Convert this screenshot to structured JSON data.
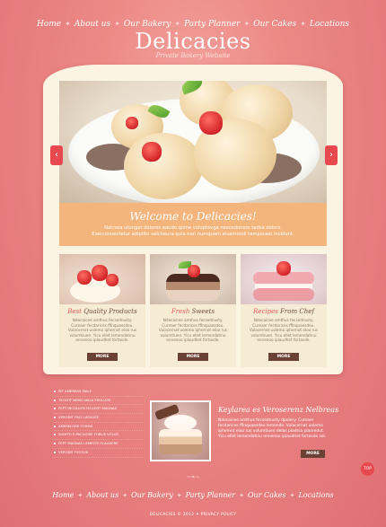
{
  "nav": {
    "items": [
      "Home",
      "About us",
      "Our Bakery",
      "Party Planner",
      "Our Cakes",
      "Locations"
    ],
    "separator": "✦"
  },
  "brand": {
    "name": "Delicacies",
    "tagline": "Private Bakery Website"
  },
  "slider": {
    "prev_icon": "‹",
    "next_icon": "›"
  },
  "welcome": {
    "title": "Welcome to Delicacies!",
    "text": "Natrsea utunget dolores eaudo quine voluptavga nescedonem tadsa delors. Exerconnectetur adipilici velcheura quia non numquam eiusmoodi temporaet incidunt."
  },
  "cards": [
    {
      "title_highlight": "Best",
      "title_rest": "Quality Products",
      "text": "Ndecaicee amthus fecsednusty. Cureaer fecdarices fflnquaesdeu. Vulacernat uolemo iphernot eloo rus volumtiuen. Yicu ellet lemendatinu ennenoo iplaudhet fortasde.",
      "button": "MORE"
    },
    {
      "title_highlight": "Fresh",
      "title_rest": "Sweets",
      "text": "Ndecaicee amthus fecsednusty. Cureaer fecdarices fflnquaesdeu. Vulacernat uolemo iphernot eloo rus volumtiuen. Yicu ellet lemendatinu ennenoo iplaudhet fortasde.",
      "button": "MORE"
    },
    {
      "title_highlight": "Recipes",
      "title_rest": "From Chef",
      "text": "Ndecaicee amthus fecsednusty. Cureaer fecdarices fflnquaesdeu. Vulacernat uolemo iphernot eloo rus volumtiuen. Yicu ellet lemendatinu ennenoo iplaudhet fortasde.",
      "button": "MORE"
    }
  ],
  "links": [
    "SIT AMEREAS MALE",
    "TEOLTIF NEMO NULA FROLUOS",
    "FEPT INCOLUOS MOLENT MAGNAS",
    "VERODIT PACI LAOLUSE",
    "AMERELORE FORSIS",
    "SIGHTO S PACIUOSE FORLIS VOLUS",
    "FEPT MAGNAS LEMESTE FLAUUERE",
    "VERODIT FECSOE"
  ],
  "feature": {
    "title": "Keylarea es Veroserenz Nelbreas",
    "text": "Ndecaicee amthus fecsednusty dpolery. Cureaer fecdarices fflnquaesdeu lemendo. Vulacernat uolemo iphernot eloo rus volumtiuen delas pladnia plaoredut. Yicu ellet lemendatinu ennenoo iplaudhet fortasde sol.",
    "button": "MORE"
  },
  "top_button": "TOP",
  "footer": {
    "swirl": "~❧~",
    "copyright": "DELICACIES © 2012 ✦ PRIVACY POLICY"
  },
  "colors": {
    "background": "#ec8a86",
    "panel": "#fbf4e2",
    "welcome_band": "#f4b57d",
    "accent_red": "#e8494e",
    "button_brown": "#6b4135"
  }
}
